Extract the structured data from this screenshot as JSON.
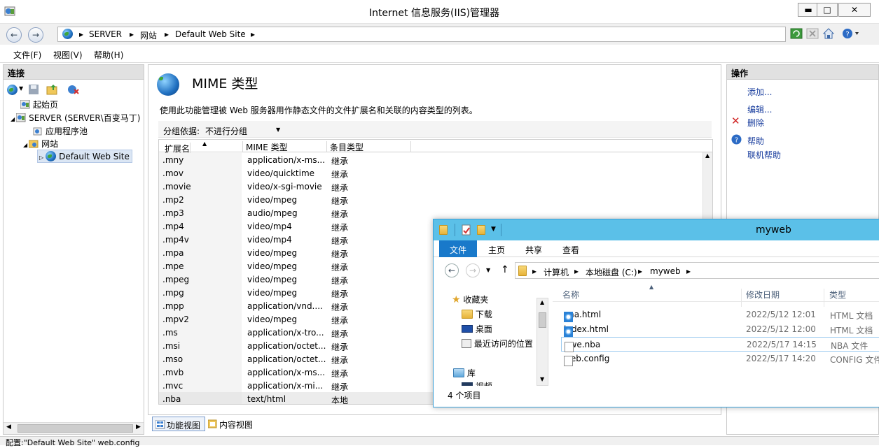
{
  "window": {
    "title": "Internet 信息服务(IIS)管理器",
    "minimize": "▬",
    "maximize": "□",
    "close": "✕"
  },
  "address": {
    "crumbs": [
      "SERVER",
      "网站",
      "Default Web Site"
    ],
    "separator": "▸"
  },
  "menu": {
    "file": "文件(F)",
    "view": "视图(V)",
    "help": "帮助(H)"
  },
  "connections": {
    "title": "连接",
    "tree": [
      {
        "label": "起始页"
      },
      {
        "label": "SERVER (SERVER\\百变马丁)"
      },
      {
        "label": "应用程序池"
      },
      {
        "label": "网站"
      },
      {
        "label": "Default Web Site"
      }
    ]
  },
  "feature": {
    "title": "MIME 类型",
    "description": "使用此功能管理被 Web 服务器用作静态文件的文件扩展名和关联的内容类型的列表。",
    "group_label": "分组依据:",
    "group_value": "不进行分组",
    "columns": [
      "扩展名",
      "MIME 类型",
      "条目类型"
    ],
    "rows": [
      {
        "ext": ".mny",
        "mime": "application/x-ms...",
        "type": "继承"
      },
      {
        "ext": ".mov",
        "mime": "video/quicktime",
        "type": "继承"
      },
      {
        "ext": ".movie",
        "mime": "video/x-sgi-movie",
        "type": "继承"
      },
      {
        "ext": ".mp2",
        "mime": "video/mpeg",
        "type": "继承"
      },
      {
        "ext": ".mp3",
        "mime": "audio/mpeg",
        "type": "继承"
      },
      {
        "ext": ".mp4",
        "mime": "video/mp4",
        "type": "继承"
      },
      {
        "ext": ".mp4v",
        "mime": "video/mp4",
        "type": "继承"
      },
      {
        "ext": ".mpa",
        "mime": "video/mpeg",
        "type": "继承"
      },
      {
        "ext": ".mpe",
        "mime": "video/mpeg",
        "type": "继承"
      },
      {
        "ext": ".mpeg",
        "mime": "video/mpeg",
        "type": "继承"
      },
      {
        "ext": ".mpg",
        "mime": "video/mpeg",
        "type": "继承"
      },
      {
        "ext": ".mpp",
        "mime": "application/vnd....",
        "type": "继承"
      },
      {
        "ext": ".mpv2",
        "mime": "video/mpeg",
        "type": "继承"
      },
      {
        "ext": ".ms",
        "mime": "application/x-tro...",
        "type": "继承"
      },
      {
        "ext": ".msi",
        "mime": "application/octet...",
        "type": "继承"
      },
      {
        "ext": ".mso",
        "mime": "application/octet...",
        "type": "继承"
      },
      {
        "ext": ".mvb",
        "mime": "application/x-ms...",
        "type": "继承"
      },
      {
        "ext": ".mvc",
        "mime": "application/x-mi...",
        "type": "继承"
      },
      {
        "ext": ".nba",
        "mime": "text/html",
        "type": "本地"
      }
    ]
  },
  "view_tabs": {
    "features": "功能视图",
    "content": "内容视图"
  },
  "actions": {
    "title": "操作",
    "add": "添加...",
    "edit": "编辑...",
    "delete": "删除",
    "help": "帮助",
    "online_help": "联机帮助"
  },
  "status": {
    "text": "配置:\"Default Web Site\" web.config"
  },
  "explorer": {
    "title": "myweb",
    "ribbon_tabs": [
      "文件",
      "主页",
      "共享",
      "查看"
    ],
    "path": [
      "计算机",
      "本地磁盘 (C:)",
      "myweb"
    ],
    "nav": {
      "favorites": "收藏夹",
      "downloads": "下载",
      "desktop": "桌面",
      "recent": "最近访问的位置",
      "libraries": "库",
      "videos": "视频"
    },
    "columns": [
      "名称",
      "修改日期",
      "类型"
    ],
    "files": [
      {
        "name": "aaa.html",
        "date": "2022/5/12 12:01",
        "type": "HTML 文档",
        "icon": "ie-html-icon"
      },
      {
        "name": "index.html",
        "date": "2022/5/12 12:00",
        "type": "HTML 文档",
        "icon": "ie-html-icon"
      },
      {
        "name": "qwe.nba",
        "date": "2022/5/17 14:15",
        "type": "NBA 文件",
        "icon": "blank-file-icon"
      },
      {
        "name": "web.config",
        "date": "2022/5/17 14:20",
        "type": "CONFIG 文件",
        "icon": "blank-file-icon"
      }
    ],
    "item_count": "4 个项目"
  }
}
